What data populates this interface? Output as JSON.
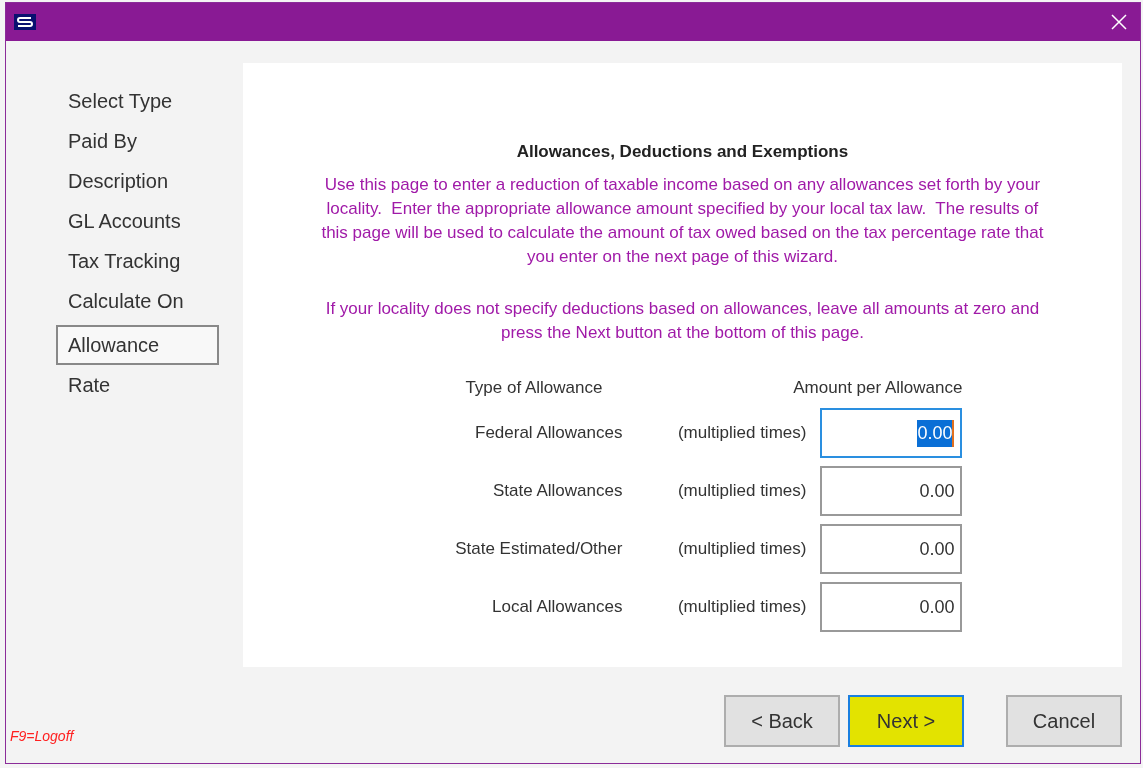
{
  "steps": [
    {
      "label": "Select Type",
      "selected": false
    },
    {
      "label": "Paid By",
      "selected": false
    },
    {
      "label": "Description",
      "selected": false
    },
    {
      "label": "GL Accounts",
      "selected": false
    },
    {
      "label": "Tax Tracking",
      "selected": false
    },
    {
      "label": "Calculate On",
      "selected": false
    },
    {
      "label": "Allowance",
      "selected": true
    },
    {
      "label": "Rate",
      "selected": false
    }
  ],
  "page": {
    "heading": "Allowances, Deductions and Exemptions",
    "intro": "Use this page to enter a reduction of taxable income based on any allowances set forth by your locality.  Enter the appropriate allowance amount specified by your local tax law.  The results of this page will be used to calculate the amount of tax owed based on the tax percentage rate that you enter on the next page of this wizard.",
    "note": "If your locality does not specify deductions based on allowances, leave all amounts at zero and press the Next button at the bottom of this page.",
    "columns": [
      "Type of Allowance",
      "Amount per Allowance"
    ],
    "rows": [
      {
        "label": "Federal Allowances",
        "multiplier": "(multiplied times)",
        "value": "0.00",
        "focused": true
      },
      {
        "label": "State Allowances",
        "multiplier": "(multiplied times)",
        "value": "0.00",
        "focused": false
      },
      {
        "label": "State Estimated/Other",
        "multiplier": "(multiplied times)",
        "value": "0.00",
        "focused": false
      },
      {
        "label": "Local Allowances",
        "multiplier": "(multiplied times)",
        "value": "0.00",
        "focused": false
      }
    ]
  },
  "hotkey": "F9=Logoff",
  "buttons": [
    {
      "label": "< Back",
      "default": false,
      "highlighted": false
    },
    {
      "label": "Next >",
      "default": true,
      "highlighted": true
    },
    {
      "label": "Cancel",
      "default": false,
      "highlighted": false
    }
  ]
}
